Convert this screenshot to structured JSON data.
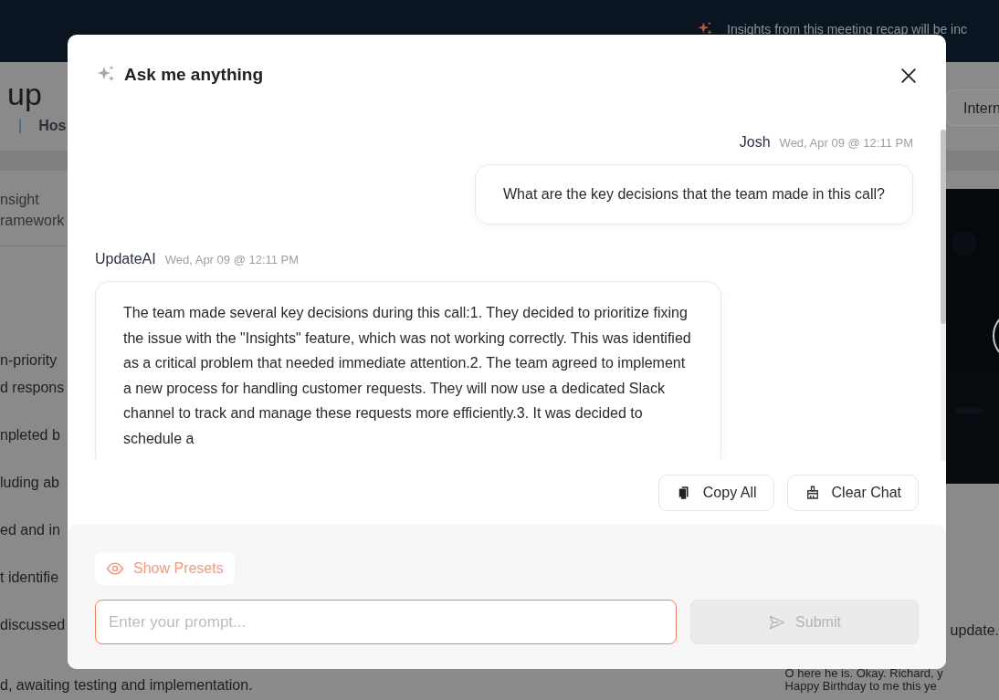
{
  "background": {
    "banner": "Insights from this meeting recap will be inc",
    "title": "up",
    "divider": "|",
    "host": "Hos",
    "tag_button": "Intern",
    "section_lines": [
      "nsight",
      "ramework"
    ],
    "notes": [
      {
        "lines": [
          "n-priority",
          "d respons"
        ]
      },
      {
        "lines": [
          "npleted b"
        ]
      },
      {
        "lines": [
          "luding ab"
        ]
      },
      {
        "lines": [
          "ed and in"
        ]
      },
      {
        "lines": [
          "t identifie"
        ]
      },
      {
        "lines": [
          "discussed"
        ]
      },
      {
        "lines": [
          "d, awaiting testing and implementation."
        ]
      }
    ],
    "transcript": [
      "update.",
      "O here he is. Okay. Richard, y",
      "Happy Birthday to me this ye"
    ]
  },
  "modal": {
    "title": "Ask me anything",
    "messages": [
      {
        "kind": "user",
        "author": "Josh",
        "time": "Wed, Apr 09 @ 12:11 PM",
        "text": "What are the key decisions that the team made in this call?"
      },
      {
        "kind": "assistant",
        "author": "UpdateAI",
        "time": "Wed, Apr 09 @ 12:11 PM",
        "text": "The team made several key decisions during this call:1. They decided to prioritize fixing the issue with the \"Insights\" feature, which was not working correctly. This was identified as a critical problem that needed immediate attention.2. The team agreed to implement a new process for handling customer requests. They will now use a dedicated Slack channel to track and manage these requests more efficiently.3. It was decided to schedule a"
      }
    ],
    "actions": [
      {
        "kind": "copy",
        "label": "Copy All"
      },
      {
        "kind": "clear",
        "label": "Clear Chat"
      }
    ],
    "presets_button": {
      "label": "Show Presets"
    },
    "prompt": {
      "placeholder": "Enter your prompt..."
    },
    "submit": {
      "label": "Submit",
      "disabled": true
    }
  }
}
